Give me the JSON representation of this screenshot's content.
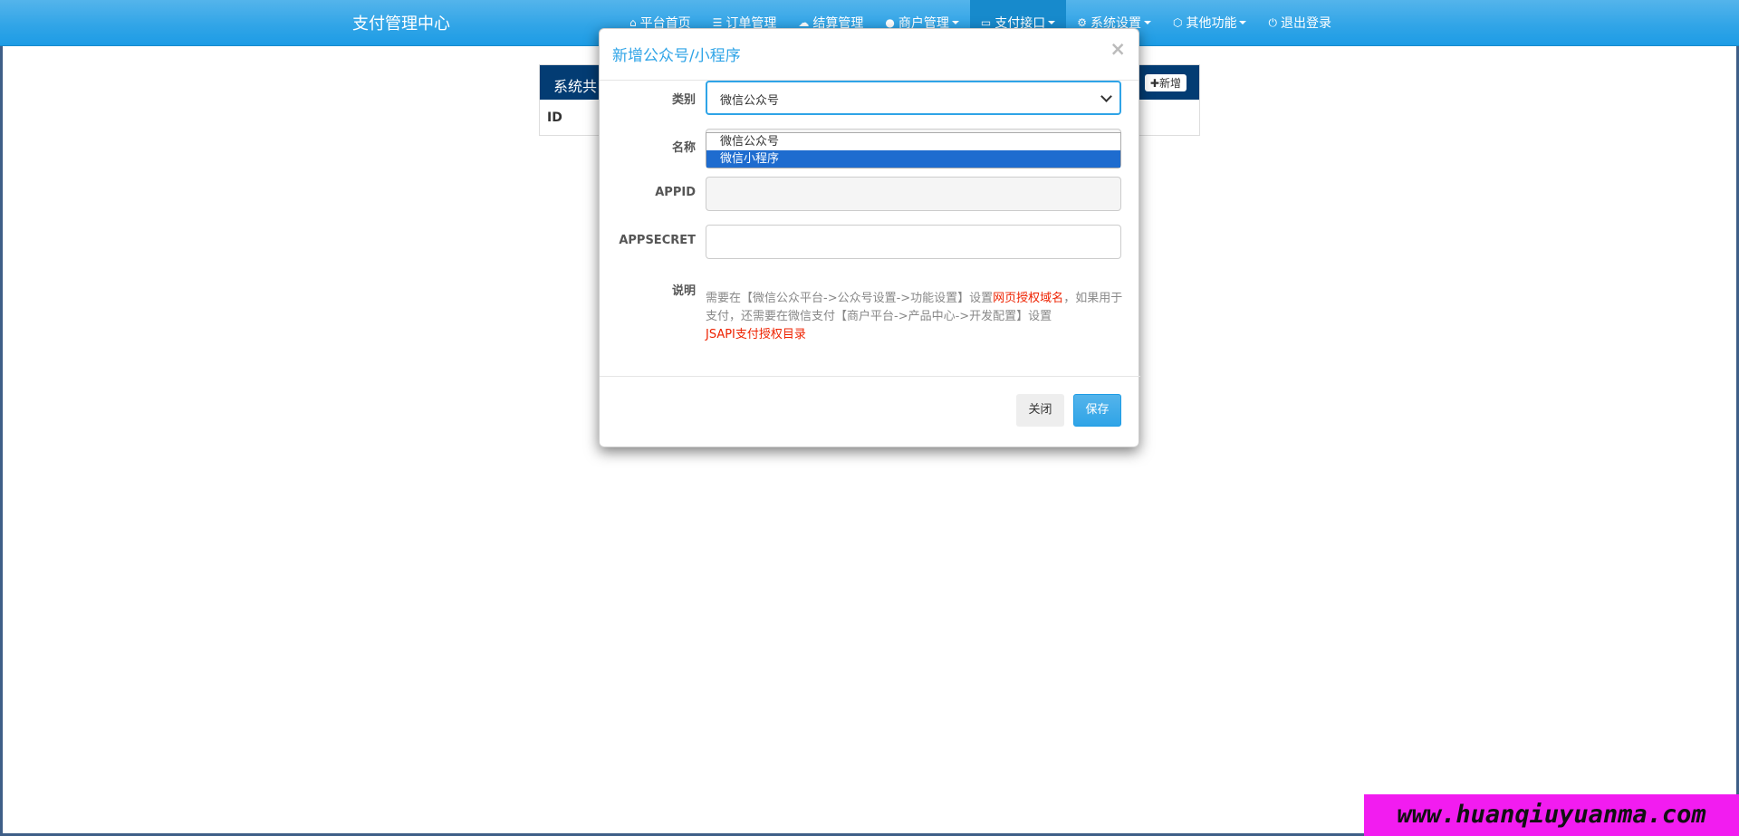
{
  "navbar": {
    "brand": "支付管理中心",
    "items": [
      {
        "label": "平台首页",
        "icon": "home-icon",
        "glyph": "⌂",
        "dropdown": false
      },
      {
        "label": "订单管理",
        "icon": "list-icon",
        "glyph": "☰",
        "dropdown": false
      },
      {
        "label": "结算管理",
        "icon": "cloud-icon",
        "glyph": "☁",
        "dropdown": false
      },
      {
        "label": "商户管理",
        "icon": "user-icon",
        "glyph": "●",
        "dropdown": true
      },
      {
        "label": "支付接口",
        "icon": "card-icon",
        "glyph": "▭",
        "dropdown": true
      },
      {
        "label": "系统设置",
        "icon": "gear-icon",
        "glyph": "⚙",
        "dropdown": true
      },
      {
        "label": "其他功能",
        "icon": "cube-icon",
        "glyph": "⬡",
        "dropdown": true
      },
      {
        "label": "退出登录",
        "icon": "power-icon",
        "glyph": "⏻",
        "dropdown": false
      }
    ]
  },
  "panel": {
    "title": "系统共",
    "add_label": "新增",
    "column_id": "ID"
  },
  "modal": {
    "title": "新增公众号/小程序",
    "close_symbol": "×",
    "fields": {
      "type_label": "类别",
      "type_value": "微信公众号",
      "type_options": [
        "微信公众号",
        "微信小程序"
      ],
      "name_label": "名称",
      "appid_label": "APPID",
      "appsecret_label": "APPSECRET",
      "desc_label": "说明"
    },
    "desc": {
      "part1": "需要在【微信公众平台->公众号设置->功能设置】设置",
      "link1": "网页授权域名",
      "part2": "，如果用于支付，还需要在微信支付【商户平台->产品中心->开发配置】设置",
      "link2": "JSAPI支付授权目录"
    },
    "buttons": {
      "close": "关闭",
      "save": "保存"
    }
  },
  "watermark": "www.huanqiuyuanma.com",
  "colors": {
    "navbar": "#2fa4e7",
    "navbar_active": "#178acc",
    "panel_head": "#033c73",
    "option_selected": "#1e6ccf",
    "link_red": "#ee2200",
    "watermark_bg": "#f21cf0"
  }
}
